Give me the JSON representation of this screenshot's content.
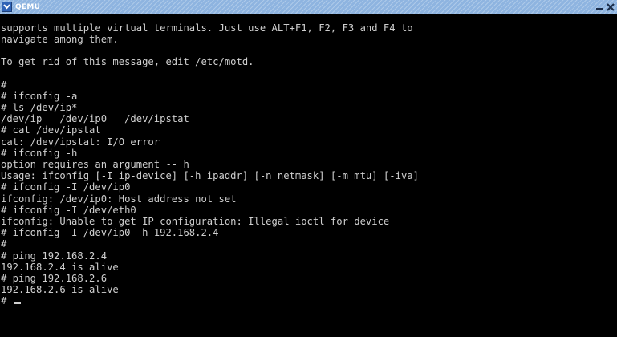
{
  "window": {
    "title": "QEMU",
    "menu_icon": "chevron-down-icon",
    "minimize_icon": "minimize-icon",
    "close_icon": "close-icon"
  },
  "terminal": {
    "lines": [
      "supports multiple virtual terminals. Just use ALT+F1, F2, F3 and F4 to",
      "navigate among them.",
      "",
      "To get rid of this message, edit /etc/motd.",
      "",
      "#",
      "# ifconfig -a",
      "# ls /dev/ip*",
      "/dev/ip   /dev/ip0   /dev/ipstat",
      "# cat /dev/ipstat",
      "cat: /dev/ipstat: I/O error",
      "# ifconfig -h",
      "option requires an argument -- h",
      "Usage: ifconfig [-I ip-device] [-h ipaddr] [-n netmask] [-m mtu] [-iva]",
      "# ifconfig -I /dev/ip0",
      "ifconfig: /dev/ip0: Host address not set",
      "# ifconfig -I /dev/eth0",
      "ifconfig: Unable to get IP configuration: Illegal ioctl for device",
      "# ifconfig -I /dev/ip0 -h 192.168.2.4",
      "#",
      "# ping 192.168.2.4",
      "192.168.2.4 is alive",
      "# ping 192.168.2.6",
      "192.168.2.6 is alive",
      "# "
    ]
  },
  "colors": {
    "titlebar": "#8eb4e0",
    "terminal_bg": "#000000",
    "terminal_fg": "#cfcfcf"
  }
}
